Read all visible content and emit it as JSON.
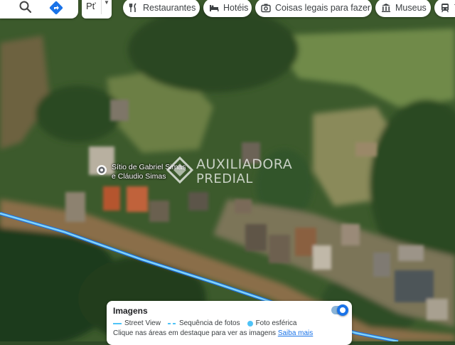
{
  "toolbar": {
    "layer_label": "Pť",
    "chips": [
      {
        "icon": "fork-knife-icon",
        "label": "Restaurantes"
      },
      {
        "icon": "bed-icon",
        "label": "Hotéis"
      },
      {
        "icon": "camera-icon",
        "label": "Coisas legais para fazer"
      },
      {
        "icon": "museum-icon",
        "label": "Museus"
      },
      {
        "icon": "transit-icon",
        "label": "T"
      }
    ]
  },
  "place": {
    "line1": "Sítio de Gabriel Simas",
    "line2": "e Cláudio Simas",
    "icon": "place-pin-icon"
  },
  "watermark": {
    "line1": "AUXILIADORA",
    "line2": "PREDIAL"
  },
  "imagery_panel": {
    "title": "Imagens",
    "legend": [
      {
        "label": "Street View",
        "style": "solid-line"
      },
      {
        "label": "Sequência de fotos",
        "style": "dashed-line"
      },
      {
        "label": "Foto esférica",
        "style": "dot"
      }
    ],
    "hint": "Clique nas áreas em destaque para ver as imagens",
    "link": "Saiba mais",
    "toggle_on": true
  },
  "colors": {
    "coverage": "#4fc3f7",
    "accent": "#1a73e8"
  }
}
